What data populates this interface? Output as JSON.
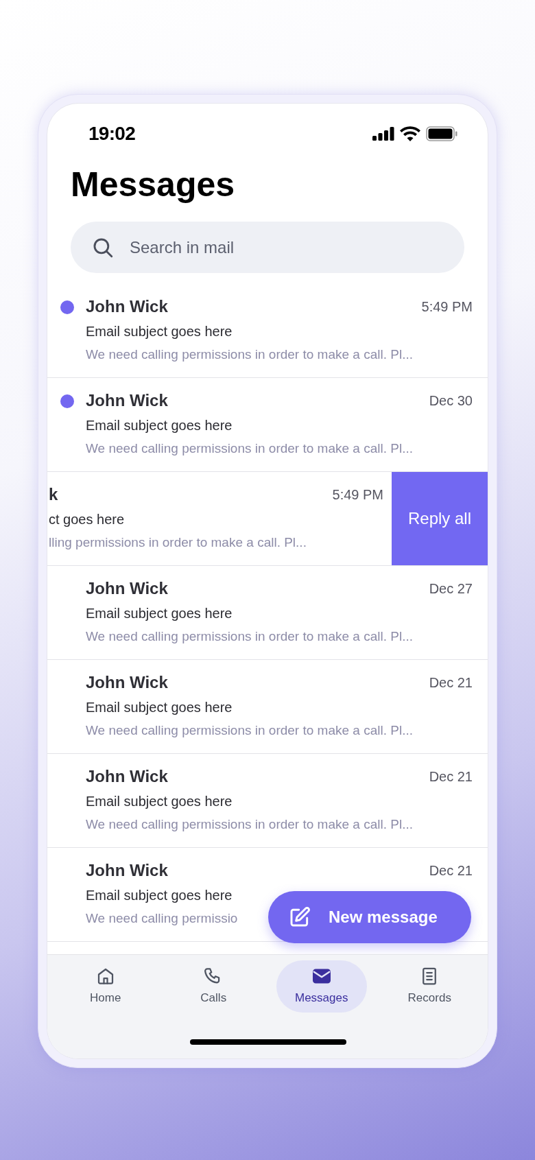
{
  "status_bar": {
    "time": "19:02"
  },
  "title": "Messages",
  "search": {
    "placeholder": "Search in mail"
  },
  "messages": [
    {
      "kind": "message",
      "unread": true,
      "name": "John Wick",
      "time": "5:49 PM",
      "subject": "Email subject goes here",
      "preview": "We need calling permissions in order to make a call. Pl..."
    },
    {
      "kind": "message",
      "unread": true,
      "name": "John Wick",
      "time": "Dec 30",
      "subject": "Email subject goes here",
      "preview": "We need calling permissions in order to make a call. Pl..."
    },
    {
      "kind": "swiped",
      "name": "k",
      "time": "5:49 PM",
      "subject": "ct goes here",
      "preview": "lling permissions in order to make a call. Pl...",
      "action": "Reply all"
    },
    {
      "kind": "message",
      "unread": false,
      "name": "John Wick",
      "time": "Dec 27",
      "subject": "Email subject goes here",
      "preview": "We need calling permissions in order to make a call. Pl..."
    },
    {
      "kind": "message",
      "unread": false,
      "name": "John Wick",
      "time": "Dec 21",
      "subject": "Email subject goes here",
      "preview": "We need calling permissions in order to make a call. Pl..."
    },
    {
      "kind": "message",
      "unread": false,
      "name": "John Wick",
      "time": "Dec 21",
      "subject": "Email subject goes here",
      "preview": "We need calling permissions in order to make a call. Pl..."
    },
    {
      "kind": "message",
      "unread": false,
      "name": "John Wick",
      "time": "Dec 21",
      "subject": "Email subject goes here",
      "preview": "We need calling permissio"
    }
  ],
  "fab": {
    "label": "New message"
  },
  "nav": [
    {
      "label": "Home",
      "selected": false
    },
    {
      "label": "Calls",
      "selected": false
    },
    {
      "label": "Messages",
      "selected": true
    },
    {
      "label": "Records",
      "selected": false
    }
  ]
}
